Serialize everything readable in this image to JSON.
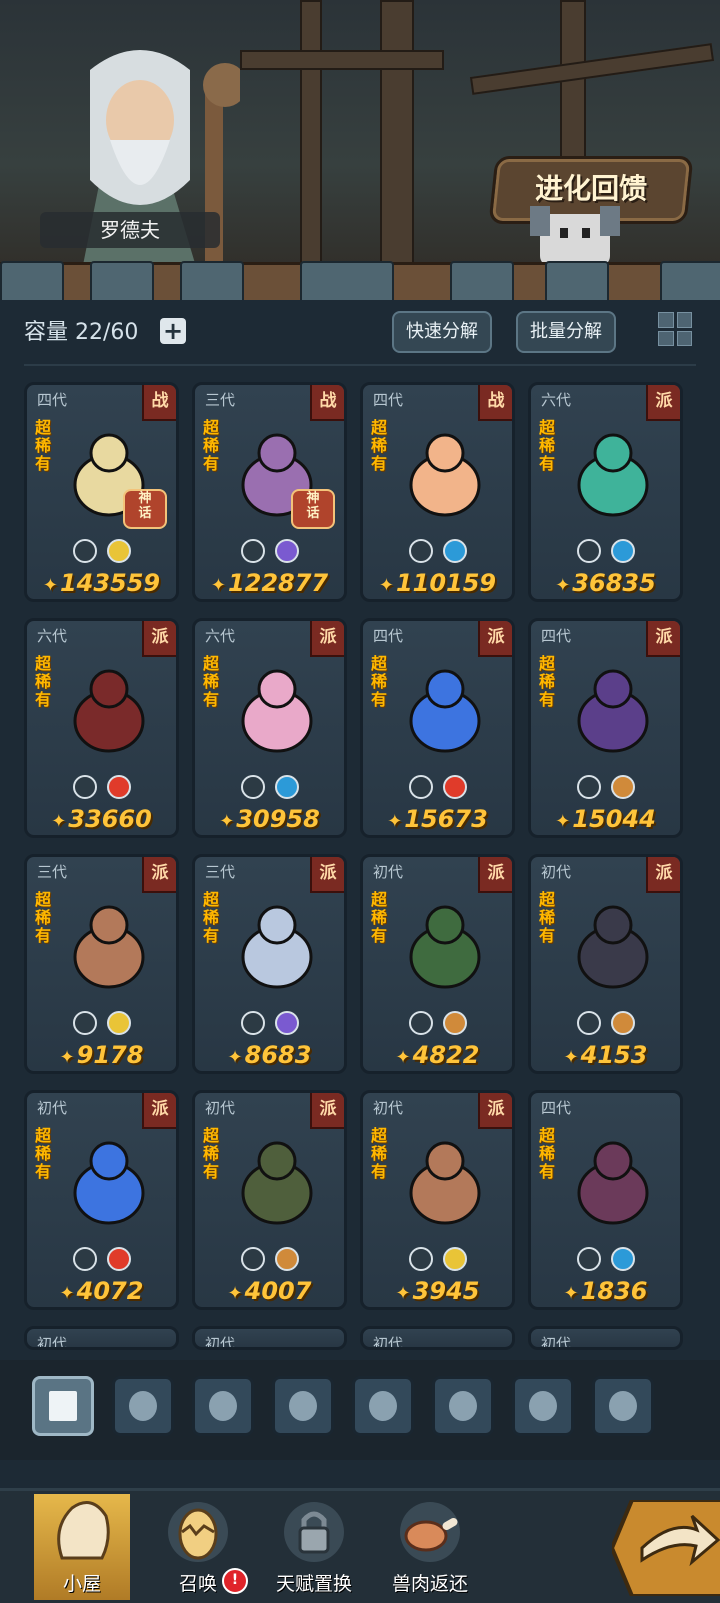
{
  "header": {
    "npc_name": "罗德夫",
    "evolve_button": "进化回馈"
  },
  "toolbar": {
    "capacity_label": "容量 22/60",
    "quick_decompose": "快速分解",
    "batch_decompose": "批量分解"
  },
  "cards": [
    {
      "gen": "四代",
      "role": "战",
      "rarity": "超稀有",
      "power": "143559",
      "mythic": "神话",
      "color": "#e8d9a0"
    },
    {
      "gen": "三代",
      "role": "战",
      "rarity": "超稀有",
      "power": "122877",
      "mythic": "神话",
      "color": "#9a6fb0"
    },
    {
      "gen": "四代",
      "role": "战",
      "rarity": "超稀有",
      "power": "110159",
      "color": "#f2b48a"
    },
    {
      "gen": "六代",
      "role": "派",
      "rarity": "超稀有",
      "power": "36835",
      "color": "#3fb39a"
    },
    {
      "gen": "六代",
      "role": "派",
      "rarity": "超稀有",
      "power": "33660",
      "color": "#7a2a2a"
    },
    {
      "gen": "六代",
      "role": "派",
      "rarity": "超稀有",
      "power": "30958",
      "color": "#e9a9c9"
    },
    {
      "gen": "四代",
      "role": "派",
      "rarity": "超稀有",
      "power": "15673",
      "color": "#3d74e0"
    },
    {
      "gen": "四代",
      "role": "派",
      "rarity": "超稀有",
      "power": "15044",
      "color": "#5b3f8a"
    },
    {
      "gen": "三代",
      "role": "派",
      "rarity": "超稀有",
      "power": "9178",
      "color": "#b3795a"
    },
    {
      "gen": "三代",
      "role": "派",
      "rarity": "超稀有",
      "power": "8683",
      "color": "#b9c8df"
    },
    {
      "gen": "初代",
      "role": "派",
      "rarity": "超稀有",
      "power": "4822",
      "color": "#3f6b3f"
    },
    {
      "gen": "初代",
      "role": "派",
      "rarity": "超稀有",
      "power": "4153",
      "color": "#3a3a4a"
    },
    {
      "gen": "初代",
      "role": "派",
      "rarity": "超稀有",
      "power": "4072",
      "color": "#3d74e0"
    },
    {
      "gen": "初代",
      "role": "派",
      "rarity": "超稀有",
      "power": "4007",
      "color": "#4f5f3c"
    },
    {
      "gen": "初代",
      "role": "派",
      "rarity": "超稀有",
      "power": "3945",
      "color": "#b3795a"
    },
    {
      "gen": "四代",
      "role": "",
      "rarity": "超稀有",
      "power": "1836",
      "color": "#6b3a5a"
    }
  ],
  "partial_row": [
    "初代",
    "初代",
    "初代",
    "初代"
  ],
  "filter_tabs": [
    "all-icon",
    "fist-icon",
    "shield-icon",
    "sprout-icon",
    "alien-icon",
    "tower-icon",
    "compass-icon",
    "eye-icon"
  ],
  "nav": {
    "cabin": "小屋",
    "summon": "召唤",
    "talent_swap": "天赋置换",
    "meat_return": "兽肉返还",
    "badge": "!"
  }
}
